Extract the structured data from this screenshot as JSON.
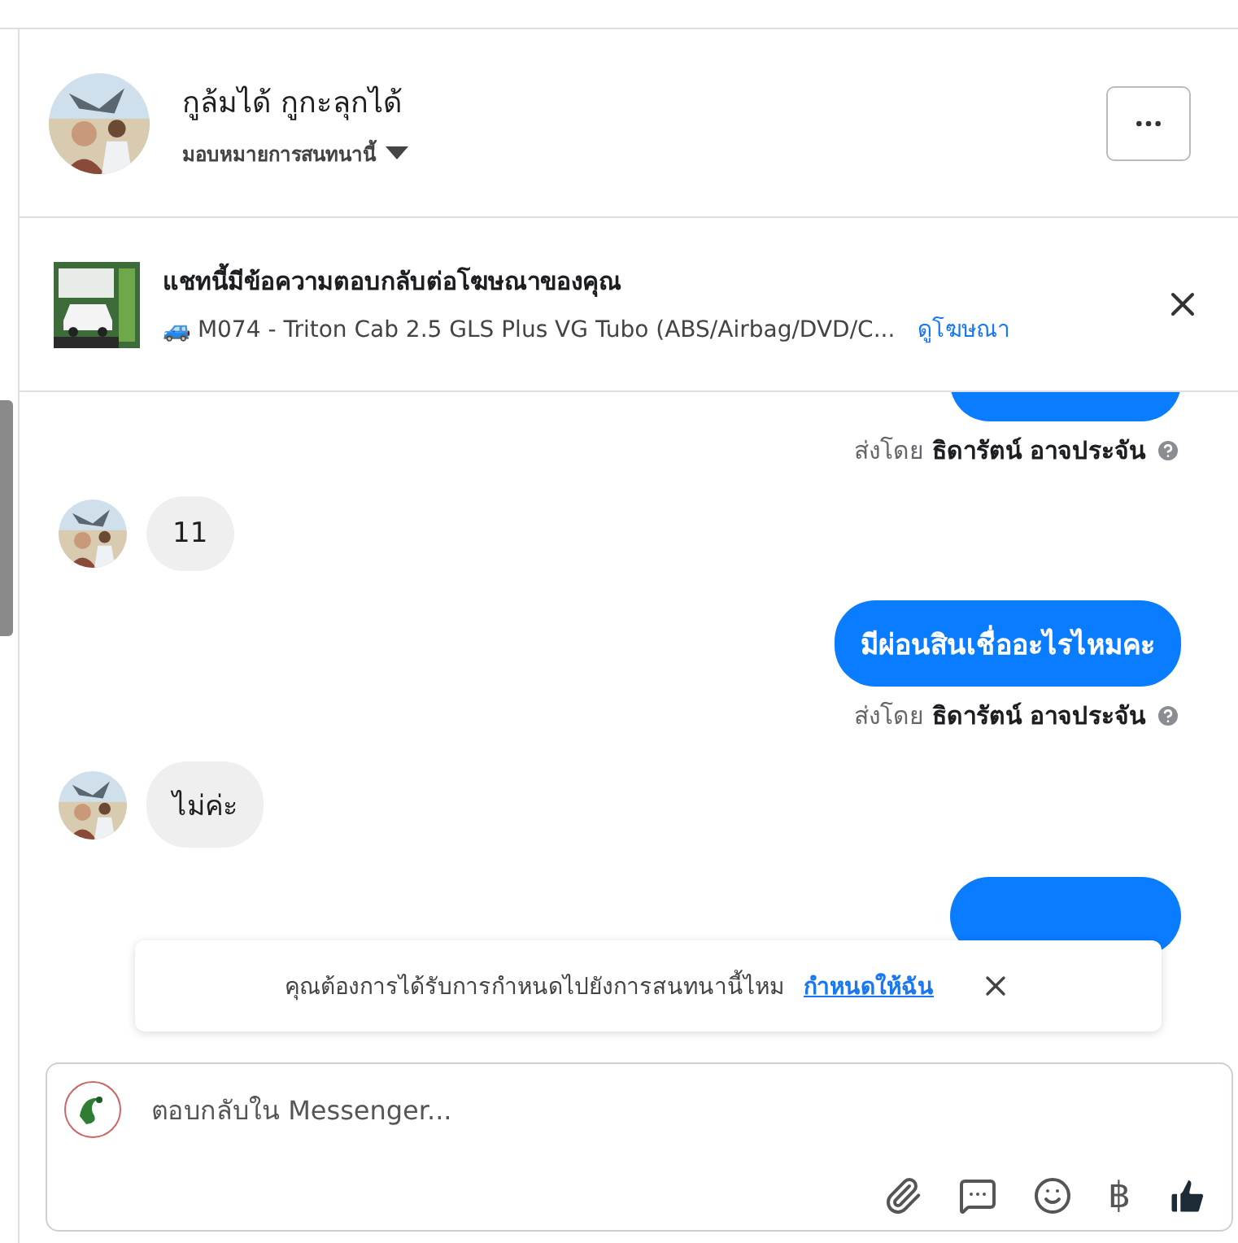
{
  "header": {
    "name": "กูล้มได้ กูกะลุกได้",
    "assign": "มอบหมายการสนทนานี้"
  },
  "ad_banner": {
    "title": "แชทนี้มีข้อความตอบกลับต่อโฆษณาของคุณ",
    "product": "🚙 M074 - Triton Cab 2.5 GLS Plus VG Tubo (ABS/Airbag/DVD/C...",
    "link": "ดูโฆษณา"
  },
  "messages": [
    {
      "kind": "clipped"
    },
    {
      "kind": "sent_by",
      "prefix": "ส่งโดย",
      "name": "ธิดารัตน์ อาจประจัน"
    },
    {
      "kind": "incoming",
      "text": "11"
    },
    {
      "kind": "outgoing",
      "text": "มีผ่อนสินเชื่ออะไรไหมคะ"
    },
    {
      "kind": "sent_by",
      "prefix": "ส่งโดย",
      "name": "ธิดารัตน์ อาจประจัน"
    },
    {
      "kind": "incoming",
      "text": "ไม่ค่ะ"
    },
    {
      "kind": "clipped"
    }
  ],
  "notice": {
    "text": "คุณต้องการได้รับการกำหนดไปยังการสนทนานี้ไหม",
    "link": "กำหนดให้ฉัน"
  },
  "composer": {
    "placeholder": "ตอบกลับใน Messenger...",
    "currency": "฿"
  }
}
